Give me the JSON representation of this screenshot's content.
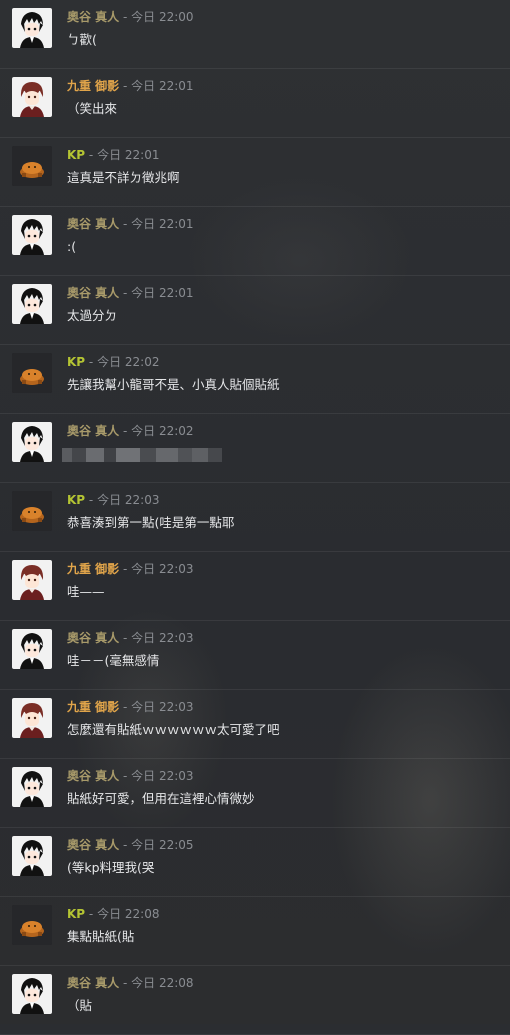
{
  "colors": {
    "okutani": "#a89a6a",
    "kokonoe": "#e0a44a",
    "kp": "#b4c433",
    "meta": "#8a8d92",
    "text": "#e6e7e9"
  },
  "messages": [
    {
      "name": "奧谷 真人",
      "sep": " - ",
      "time": "今日 22:00",
      "text": "ㄅ歡(",
      "avatar": "okutani"
    },
    {
      "name": "九重 御影",
      "sep": " - ",
      "time": "今日 22:01",
      "text": "（笑出來",
      "avatar": "kokonoe"
    },
    {
      "name": "KP",
      "sep": " - ",
      "time": "今日 22:01",
      "text": "這真是不詳ㄉ徵兆啊",
      "avatar": "kp"
    },
    {
      "name": "奧谷 真人",
      "sep": " - ",
      "time": "今日 22:01",
      "text": ":(",
      "avatar": "okutani"
    },
    {
      "name": "奧谷 真人",
      "sep": " - ",
      "time": "今日 22:01",
      "text": "太過分ㄉ",
      "avatar": "okutani"
    },
    {
      "name": "KP",
      "sep": " - ",
      "time": "今日 22:02",
      "text": "先讓我幫小龍哥不是、小真人貼個貼紙",
      "avatar": "kp"
    },
    {
      "name": "奧谷 真人",
      "sep": " - ",
      "time": "今日 22:02",
      "text": "",
      "avatar": "okutani"
    },
    {
      "name": "KP",
      "sep": " - ",
      "time": "今日 22:03",
      "text": "恭喜湊到第一點(哇是第一點耶",
      "avatar": "kp"
    },
    {
      "name": "九重 御影",
      "sep": " - ",
      "time": "今日 22:03",
      "text": "哇——",
      "avatar": "kokonoe"
    },
    {
      "name": "奧谷 真人",
      "sep": " - ",
      "time": "今日 22:03",
      "text": "哇－－(毫無感情",
      "avatar": "okutani"
    },
    {
      "name": "九重 御影",
      "sep": " - ",
      "time": "今日 22:03",
      "text": "怎麼還有貼紙ｗｗｗｗｗｗ太可愛了吧",
      "avatar": "kokonoe"
    },
    {
      "name": "奧谷 真人",
      "sep": " - ",
      "time": "今日 22:03",
      "text": "貼紙好可愛，但用在這裡心情微妙",
      "avatar": "okutani"
    },
    {
      "name": "奧谷 真人",
      "sep": " - ",
      "time": "今日 22:05",
      "text": "(等kp料理我(哭",
      "avatar": "okutani"
    },
    {
      "name": "KP",
      "sep": " - ",
      "time": "今日 22:08",
      "text": "集點貼紙(貼",
      "avatar": "kp"
    },
    {
      "name": "奧谷 真人",
      "sep": " - ",
      "time": "今日 22:08",
      "text": "（貼",
      "avatar": "okutani"
    }
  ]
}
